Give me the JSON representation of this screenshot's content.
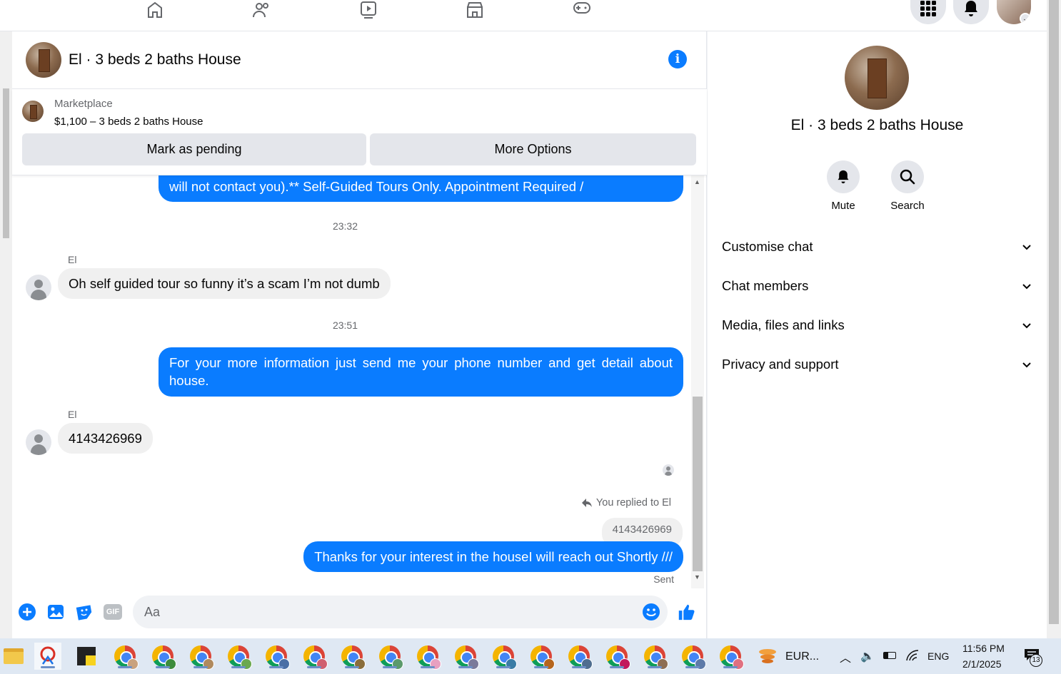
{
  "chat": {
    "title": "El · 3 beds 2 baths House"
  },
  "marketplace": {
    "label": "Marketplace",
    "item": "$1,100 – 3 beds 2 baths House",
    "mark_pending": "Mark as pending",
    "more_options": "More Options"
  },
  "messages": {
    "m1": "will not contact you).** Self-Guided Tours Only. Appointment Required /",
    "t1": "23:32",
    "sender1": "El",
    "m2": "Oh self guided tour so funny it’s a scam I’m not dumb",
    "t2": "23:51",
    "m3": "For  your  more  information  just  send  me   your  phone  number  and get detail about house.",
    "sender2": "El",
    "m4": "4143426969",
    "reply_note": "You replied to El",
    "quoted": "4143426969",
    "m5": "Thanks for your interest in the houseI will reach out Shortly ///",
    "sent": "Sent"
  },
  "composer": {
    "placeholder": "Aa",
    "gif": "GIF"
  },
  "panel": {
    "title": "El · 3 beds 2 baths House",
    "mute": "Mute",
    "search": "Search",
    "rows": [
      "Customise chat",
      "Chat members",
      "Media, files and links",
      "Privacy and support"
    ]
  },
  "taskbar": {
    "weather": "EUR...",
    "lang": "ENG",
    "time": "11:56 PM",
    "date": "2/1/2025",
    "notif_count": "13"
  },
  "colors": {
    "accent": "#0a7cff",
    "bubble_in": "#f0f0f0"
  }
}
